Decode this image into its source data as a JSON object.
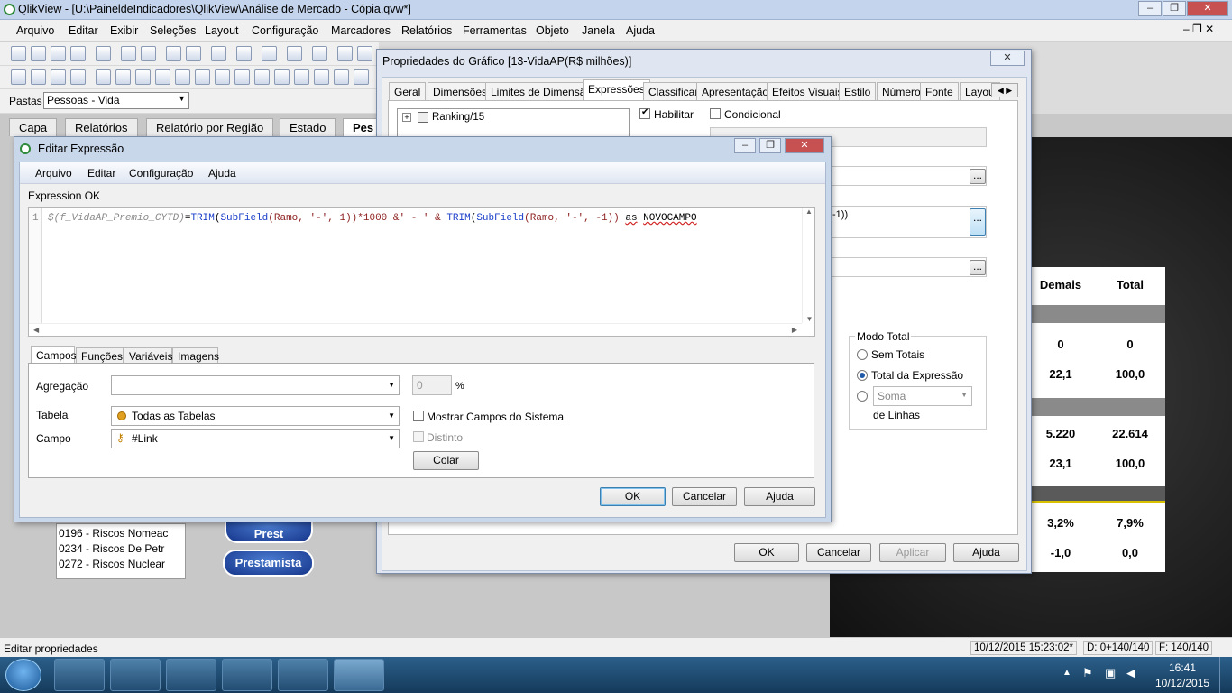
{
  "app": {
    "title": "QlikView - [U:\\PaineldeIndicadores\\QlikView\\Análise de Mercado - Cópia.qvw*]"
  },
  "menu": [
    "Arquivo",
    "Editar",
    "Exibir",
    "Seleções",
    "Layout",
    "Configuração",
    "Marcadores",
    "Relatórios",
    "Ferramentas",
    "Objeto",
    "Janela",
    "Ajuda"
  ],
  "pastas": {
    "label": "Pastas",
    "value": "Pessoas - Vida"
  },
  "sheet_tabs": [
    "Capa",
    "Relatórios",
    "Relatório por Região",
    "Estado",
    "Pes"
  ],
  "props": {
    "title": "Propriedades do Gráfico [13-VidaAP(R$ milhões)]",
    "tabs": [
      "Geral",
      "Dimensões",
      "Limites de Dimensão",
      "Expressões",
      "Classificar",
      "Apresentação",
      "Efeitos Visuais",
      "Estilo",
      "Número",
      "Fonte",
      "Layou"
    ],
    "tree_item": "Ranking/15",
    "habilitar": "Habilitar",
    "condicional": "Condicional",
    "partial_text": "-1))",
    "modo_total": "Modo Total",
    "sem_totais": "Sem Totais",
    "total_expressao": "Total da Expressão",
    "soma": "Soma",
    "de_linhas": "de Linhas",
    "ok": "OK",
    "cancelar": "Cancelar",
    "aplicar": "Aplicar",
    "ajuda": "Ajuda"
  },
  "edit": {
    "title": "Editar Expressão",
    "menu": [
      "Arquivo",
      "Editar",
      "Configuração",
      "Ajuda"
    ],
    "status": "Expression OK",
    "line_no": "1",
    "code": {
      "var": "$(f_VidaAP_Premio_CYTD)",
      "eq": "=",
      "trim1": "TRIM",
      "p1": "(",
      "subfield1": "SubField",
      "args1": "(Ramo, '-', 1))*1000 &' - ' & ",
      "trim2": "TRIM",
      "p2": "(",
      "subfield2": "SubField",
      "args2": "(Ramo, '-', -1)) ",
      "as": "as",
      "newfield": "NOVOCAMPO"
    },
    "tabs": [
      "Campos",
      "Funções",
      "Variáveis",
      "Imagens"
    ],
    "agregacao_label": "Agregação",
    "agregacao_value": "",
    "pct_value": "0",
    "pct_sign": "%",
    "tabela_label": "Tabela",
    "tabela_value": "Todas as Tabelas",
    "campo_label": "Campo",
    "campo_value": "#Link",
    "mostrar_campos": "Mostrar Campos do Sistema",
    "distinto": "Distinto",
    "colar": "Colar",
    "ok": "OK",
    "cancelar": "Cancelar",
    "ajuda": "Ajuda"
  },
  "table": {
    "headers": [
      "Demais",
      "Total"
    ],
    "rows": [
      [
        "0",
        "0"
      ],
      [
        "22,1",
        "100,0"
      ],
      [
        "5.220",
        "22.614"
      ],
      [
        "23,1",
        "100,0"
      ],
      [
        "3,2%",
        "7,9%"
      ],
      [
        "-1,0",
        "0,0"
      ]
    ]
  },
  "listbox": [
    "0196 - Riscos Nomeac",
    "0234 - Riscos De Petr",
    "0272 - Riscos Nuclear"
  ],
  "buttons": {
    "prest": "Prest",
    "prestamista": "Prestamista"
  },
  "status": {
    "left": "Editar propriedades",
    "date": "10/12/2015 15:23:02*",
    "d": "D: 0+140/140",
    "f": "F: 140/140"
  },
  "clock": {
    "time": "16:41",
    "date": "10/12/2015"
  },
  "colors": {
    "accent": "#3399ff",
    "title_bg": "#c4d4ec"
  }
}
